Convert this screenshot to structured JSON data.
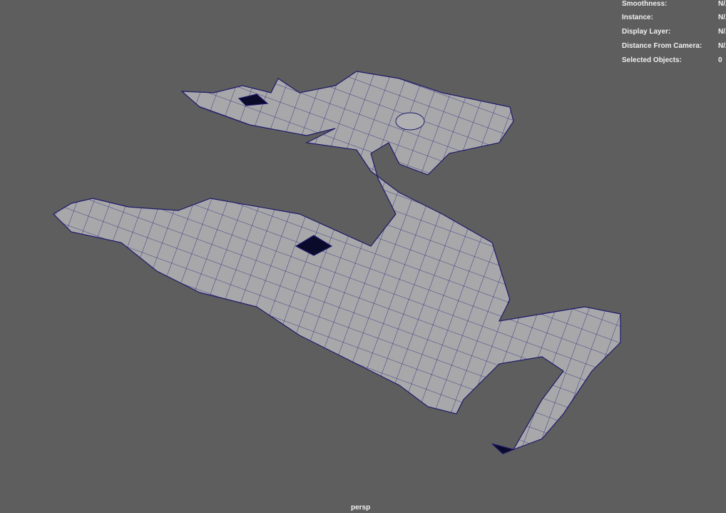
{
  "hud": [
    {
      "label": "Smoothness:",
      "value": "N/A"
    },
    {
      "label": "Instance:",
      "value": "N/A"
    },
    {
      "label": "Display Layer:",
      "value": "N/A"
    },
    {
      "label": "Distance From Camera:",
      "value": "N/A"
    },
    {
      "label": "Selected Objects:",
      "value": "0"
    }
  ],
  "camera_label": "persp",
  "colors": {
    "background": "#5e5e5e",
    "mesh": "#a5a5a8",
    "wireframe": "#1e1a6b"
  }
}
